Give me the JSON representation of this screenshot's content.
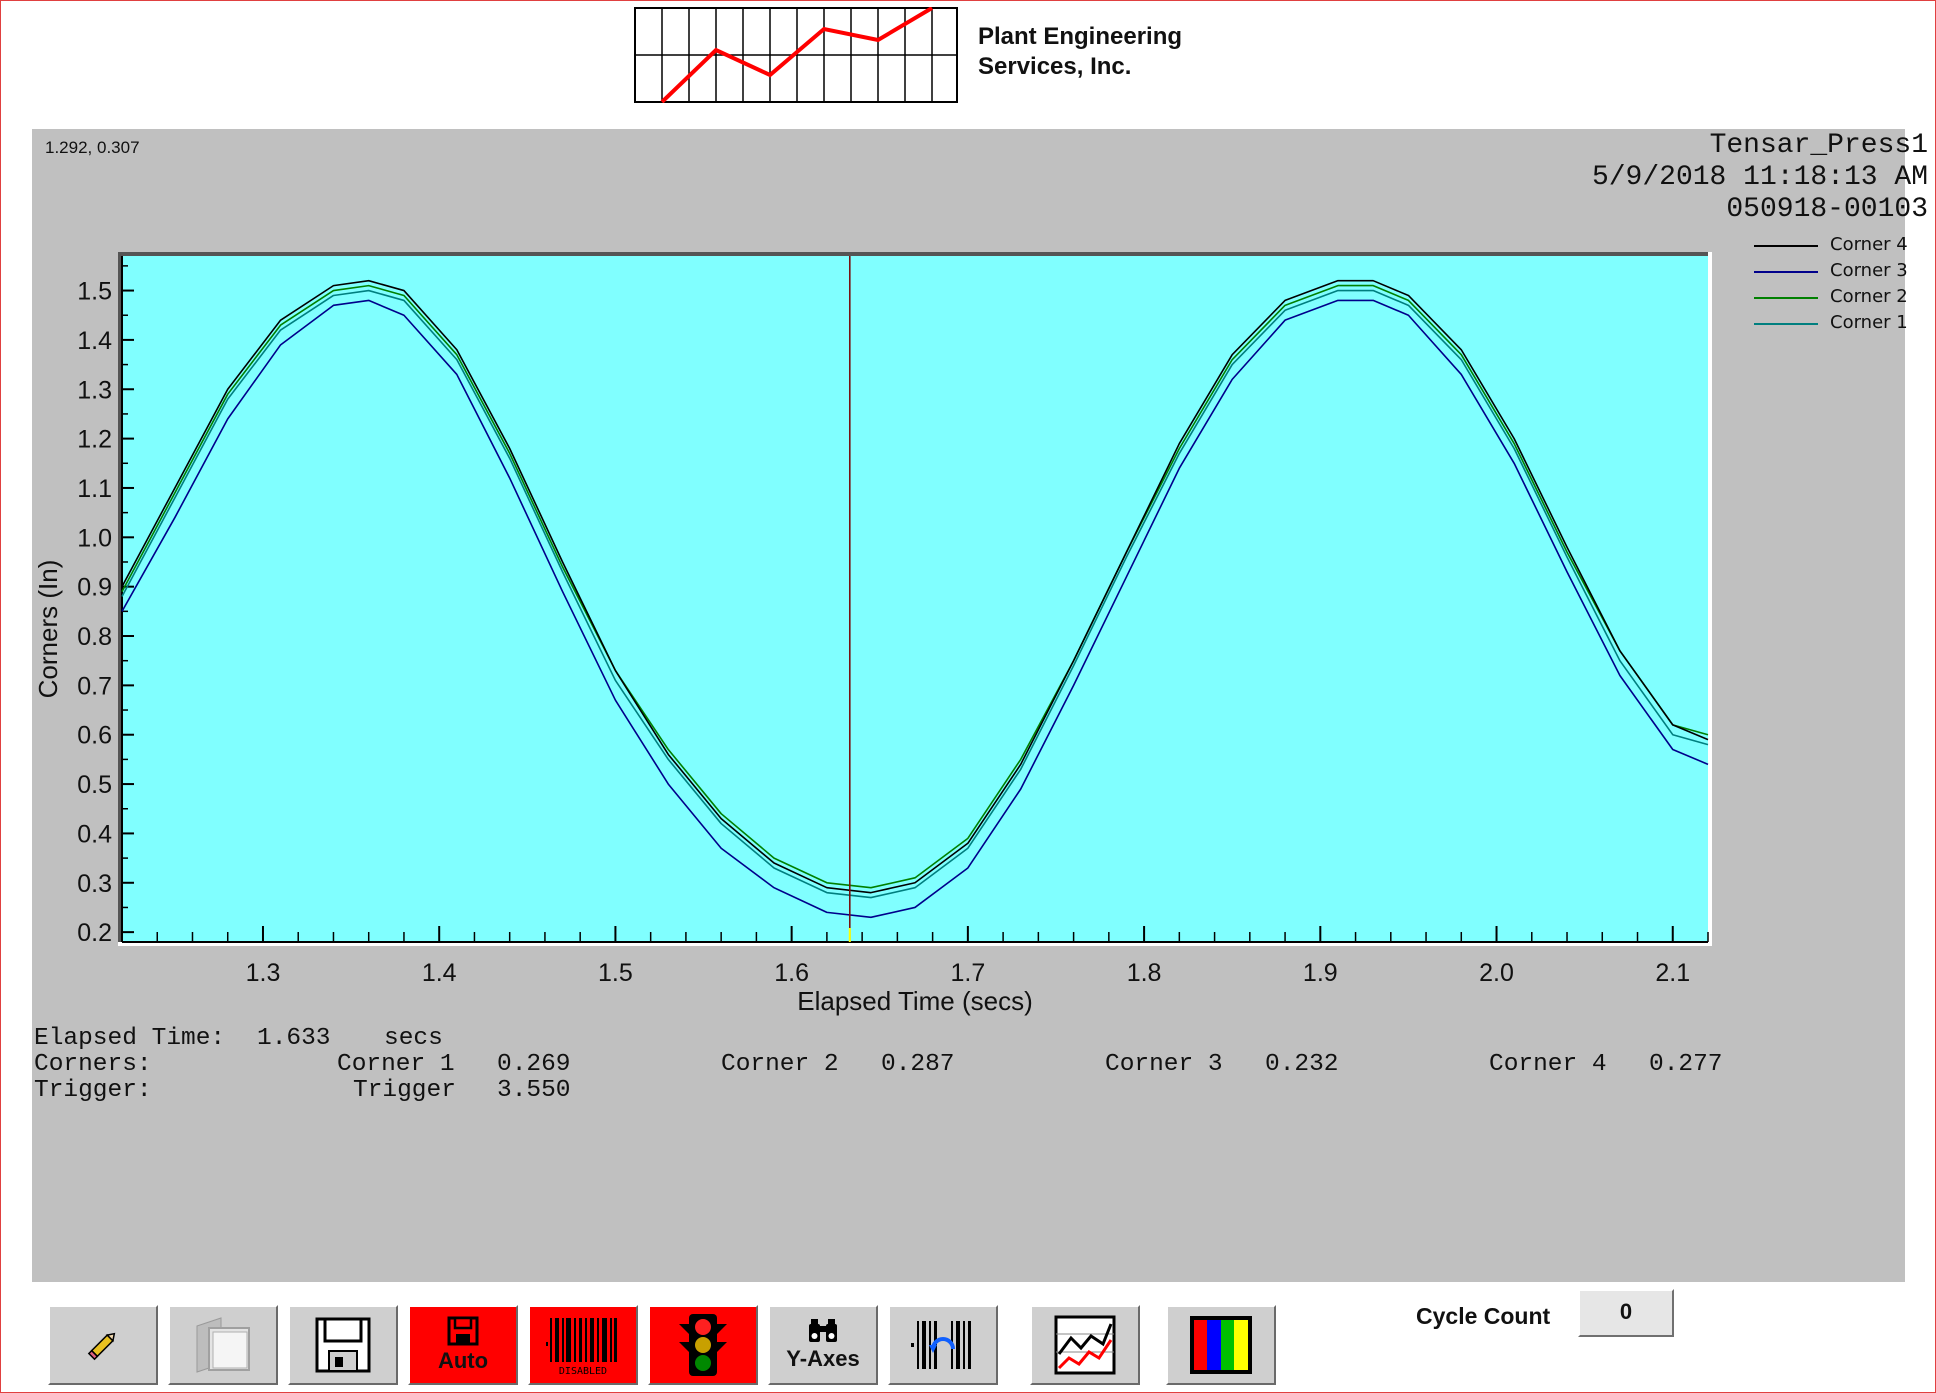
{
  "company": {
    "line1": "Plant Engineering",
    "line2": "Services, Inc."
  },
  "cursor_coords": "1.292, 0.307",
  "header": {
    "title": "Tensar_Press1",
    "datetime": "5/9/2018  11:18:13 AM",
    "record_id": "050918-00103"
  },
  "legend": [
    {
      "label": "Corner 4",
      "color": "#000000"
    },
    {
      "label": "Corner 3",
      "color": "#00008b"
    },
    {
      "label": "Corner 2",
      "color": "#008000"
    },
    {
      "label": "Corner 1",
      "color": "#007f7f"
    }
  ],
  "chart_data": {
    "type": "line",
    "xlabel": "Elapsed Time (secs)",
    "ylabel": "Corners (In)",
    "xlim": [
      1.22,
      2.12
    ],
    "ylim": [
      0.18,
      1.57
    ],
    "xticks": [
      "1.3",
      "1.4",
      "1.5",
      "1.6",
      "1.7",
      "1.8",
      "1.9",
      "2.0",
      "2.1"
    ],
    "yticks": [
      "0.2",
      "0.3",
      "0.4",
      "0.5",
      "0.6",
      "0.7",
      "0.8",
      "0.9",
      "1.0",
      "1.1",
      "1.2",
      "1.3",
      "1.4",
      "1.5"
    ],
    "background": "#80ffff",
    "cursor_x": 1.633,
    "series": [
      {
        "name": "Corner 4",
        "color": "#000000",
        "x": [
          1.22,
          1.25,
          1.28,
          1.31,
          1.34,
          1.36,
          1.38,
          1.41,
          1.44,
          1.47,
          1.5,
          1.53,
          1.56,
          1.59,
          1.62,
          1.645,
          1.67,
          1.7,
          1.73,
          1.76,
          1.79,
          1.82,
          1.85,
          1.88,
          1.91,
          1.93,
          1.95,
          1.98,
          2.01,
          2.04,
          2.07,
          2.1,
          2.12
        ],
        "y": [
          0.9,
          1.1,
          1.3,
          1.44,
          1.51,
          1.52,
          1.5,
          1.38,
          1.18,
          0.95,
          0.73,
          0.56,
          0.43,
          0.34,
          0.29,
          0.28,
          0.3,
          0.38,
          0.54,
          0.75,
          0.97,
          1.19,
          1.37,
          1.48,
          1.52,
          1.52,
          1.49,
          1.38,
          1.2,
          0.98,
          0.77,
          0.62,
          0.59
        ]
      },
      {
        "name": "Corner 3",
        "color": "#00008b",
        "x": [
          1.22,
          1.25,
          1.28,
          1.31,
          1.34,
          1.36,
          1.38,
          1.41,
          1.44,
          1.47,
          1.5,
          1.53,
          1.56,
          1.59,
          1.62,
          1.645,
          1.67,
          1.7,
          1.73,
          1.76,
          1.79,
          1.82,
          1.85,
          1.88,
          1.91,
          1.93,
          1.95,
          1.98,
          2.01,
          2.04,
          2.07,
          2.1,
          2.12
        ],
        "y": [
          0.85,
          1.04,
          1.24,
          1.39,
          1.47,
          1.48,
          1.45,
          1.33,
          1.12,
          0.89,
          0.67,
          0.5,
          0.37,
          0.29,
          0.24,
          0.23,
          0.25,
          0.33,
          0.49,
          0.7,
          0.92,
          1.14,
          1.32,
          1.44,
          1.48,
          1.48,
          1.45,
          1.33,
          1.15,
          0.93,
          0.72,
          0.57,
          0.54
        ]
      },
      {
        "name": "Corner 2",
        "color": "#008000",
        "x": [
          1.22,
          1.25,
          1.28,
          1.31,
          1.34,
          1.36,
          1.38,
          1.41,
          1.44,
          1.47,
          1.5,
          1.53,
          1.56,
          1.59,
          1.62,
          1.645,
          1.67,
          1.7,
          1.73,
          1.76,
          1.79,
          1.82,
          1.85,
          1.88,
          1.91,
          1.93,
          1.95,
          1.98,
          2.01,
          2.04,
          2.07,
          2.1,
          2.12
        ],
        "y": [
          0.89,
          1.09,
          1.29,
          1.43,
          1.5,
          1.51,
          1.49,
          1.37,
          1.17,
          0.94,
          0.73,
          0.57,
          0.44,
          0.35,
          0.3,
          0.29,
          0.31,
          0.39,
          0.55,
          0.75,
          0.97,
          1.18,
          1.36,
          1.47,
          1.51,
          1.51,
          1.48,
          1.37,
          1.19,
          0.97,
          0.77,
          0.62,
          0.6
        ]
      },
      {
        "name": "Corner 1",
        "color": "#007f7f",
        "x": [
          1.22,
          1.25,
          1.28,
          1.31,
          1.34,
          1.36,
          1.38,
          1.41,
          1.44,
          1.47,
          1.5,
          1.53,
          1.56,
          1.59,
          1.62,
          1.645,
          1.67,
          1.7,
          1.73,
          1.76,
          1.79,
          1.82,
          1.85,
          1.88,
          1.91,
          1.93,
          1.95,
          1.98,
          2.01,
          2.04,
          2.07,
          2.1,
          2.12
        ],
        "y": [
          0.88,
          1.08,
          1.28,
          1.42,
          1.49,
          1.5,
          1.48,
          1.36,
          1.16,
          0.93,
          0.71,
          0.55,
          0.42,
          0.33,
          0.28,
          0.27,
          0.29,
          0.37,
          0.53,
          0.74,
          0.96,
          1.17,
          1.35,
          1.46,
          1.5,
          1.5,
          1.47,
          1.36,
          1.18,
          0.96,
          0.75,
          0.6,
          0.58
        ]
      }
    ]
  },
  "readout": {
    "elapsed_label": "Elapsed Time:",
    "elapsed_value": "1.633",
    "elapsed_unit": "secs",
    "corners_label": "Corners:",
    "corner1_label": "Corner 1",
    "corner1_value": "0.269",
    "corner2_label": "Corner 2",
    "corner2_value": "0.287",
    "corner3_label": "Corner 3",
    "corner3_value": "0.232",
    "corner4_label": "Corner 4",
    "corner4_value": "0.277",
    "trigger_label": "Trigger:",
    "trigger_name": "Trigger",
    "trigger_value": "3.550"
  },
  "toolbar": {
    "auto_label": "Auto",
    "disabled_label": "DISABLED",
    "yaxes_label": "Y-Axes"
  },
  "cycle": {
    "label": "Cycle Count",
    "value": "0"
  }
}
